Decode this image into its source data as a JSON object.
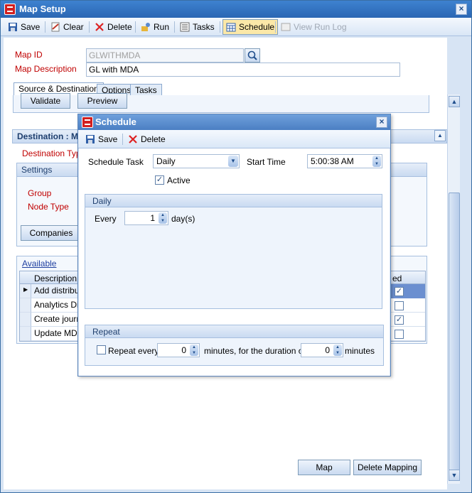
{
  "window": {
    "title": "Map Setup"
  },
  "toolbar": {
    "save": "Save",
    "clear": "Clear",
    "delete": "Delete",
    "run": "Run",
    "tasks": "Tasks",
    "schedule": "Schedule",
    "view_run_log": "View Run Log"
  },
  "form": {
    "map_id_label": "Map ID",
    "map_id_value": "GLWITHMDA",
    "map_desc_label": "Map Description",
    "map_desc_value": "GL with MDA"
  },
  "tabs": [
    "Source & Destination",
    "Options",
    "Tasks"
  ],
  "source_buttons": {
    "validate": "Validate",
    "preview": "Preview"
  },
  "destination": {
    "header": "Destination : Mi",
    "type_label": "Destination Type",
    "settings_header": "Settings",
    "group_label": "Group",
    "node_type_label": "Node Type",
    "companies_button": "Companies"
  },
  "available": {
    "link": "Available",
    "column_description": "Description",
    "column_enabled": "ed",
    "rows": [
      {
        "description": "Add distributi",
        "enabled": true
      },
      {
        "description": "Analytics Dist",
        "enabled": false
      },
      {
        "description": "Create journa",
        "enabled": true
      },
      {
        "description": "Update MDA",
        "enabled": false
      }
    ]
  },
  "bottom_buttons": {
    "map": "Map",
    "delete_mapping": "Delete Mapping"
  },
  "schedule_dialog": {
    "title": "Schedule",
    "save": "Save",
    "delete": "Delete",
    "schedule_task_label": "Schedule Task",
    "schedule_task_value": "Daily",
    "start_time_label": "Start Time",
    "start_time_value": "5:00:38 AM",
    "active_label": "Active",
    "active_checked": true,
    "daily_header": "Daily",
    "every_label": "Every",
    "every_value": "1",
    "every_unit": "day(s)",
    "repeat_header": "Repeat",
    "repeat_every_label": "Repeat every",
    "repeat_checked": false,
    "repeat_minutes_value": "0",
    "repeat_minutes_text": "minutes, for the duration of",
    "duration_value": "0",
    "duration_unit": "minutes"
  }
}
